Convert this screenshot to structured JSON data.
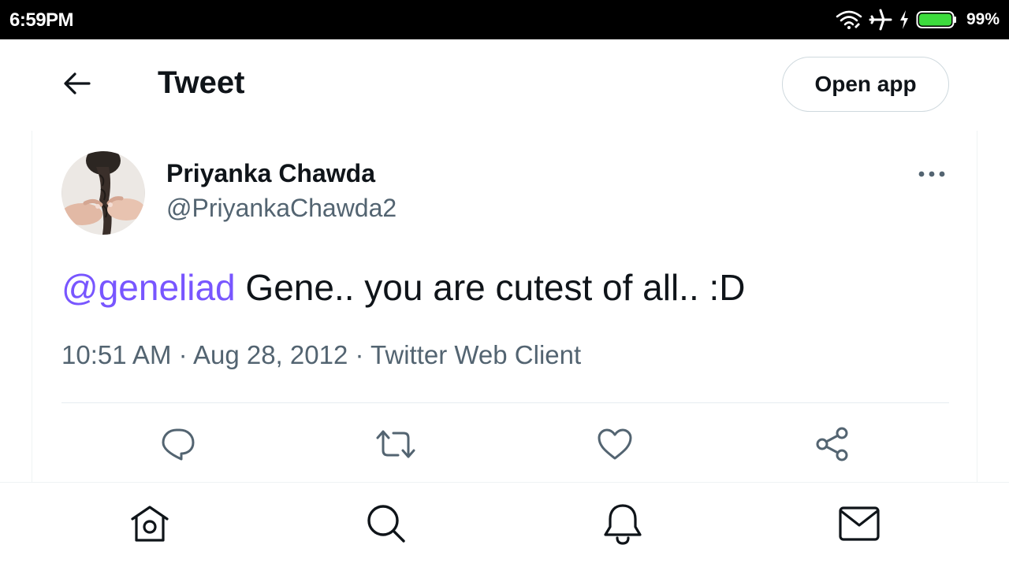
{
  "status_bar": {
    "time": "6:59PM",
    "battery_percent": "99%",
    "icons": [
      "wifi-icon",
      "airplane-icon",
      "charging-icon",
      "battery-icon"
    ]
  },
  "header": {
    "title": "Tweet",
    "open_app_label": "Open app",
    "back_icon": "arrow-left-icon"
  },
  "tweet": {
    "author_name": "Priyanka Chawda",
    "author_handle": "@PriyankaChawda2",
    "mention": "@geneliad",
    "text": " Gene.. you are cutest of all.. :D",
    "time": "10:51 AM",
    "separator": " · ",
    "date": "Aug 28, 2012",
    "source": "Twitter Web Client",
    "actions": [
      "reply-icon",
      "retweet-icon",
      "like-icon",
      "share-icon"
    ]
  },
  "bottom_nav": {
    "items": [
      "home-icon",
      "search-icon",
      "notifications-icon",
      "messages-icon"
    ]
  },
  "colors": {
    "mention": "#7856ff",
    "secondary_text": "#536471",
    "primary_text": "#0f1419",
    "battery_fill": "#3ddc3d",
    "border": "#cfd9de"
  }
}
